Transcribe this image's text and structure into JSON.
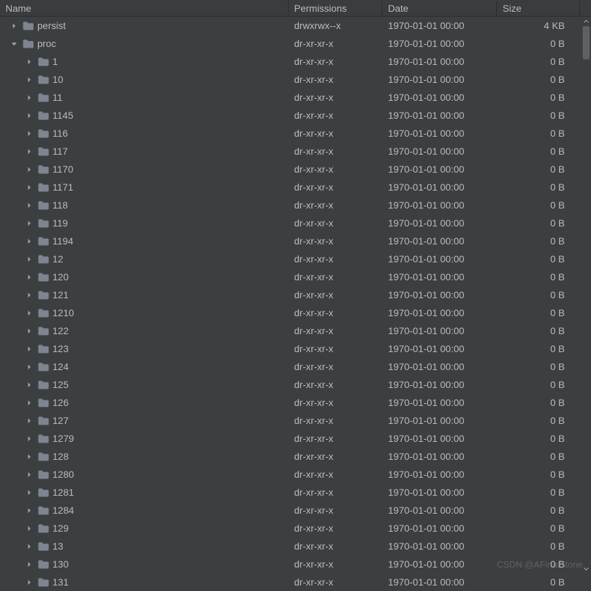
{
  "columns": {
    "name": "Name",
    "permissions": "Permissions",
    "date": "Date",
    "size": "Size"
  },
  "rows": [
    {
      "name": "persist",
      "permissions": "drwxrwx--x",
      "date": "1970-01-01 00:00",
      "size": "4 KB",
      "indent": 0,
      "expanded": false
    },
    {
      "name": "proc",
      "permissions": "dr-xr-xr-x",
      "date": "1970-01-01 00:00",
      "size": "0 B",
      "indent": 0,
      "expanded": true
    },
    {
      "name": "1",
      "permissions": "dr-xr-xr-x",
      "date": "1970-01-01 00:00",
      "size": "0 B",
      "indent": 1,
      "expanded": false
    },
    {
      "name": "10",
      "permissions": "dr-xr-xr-x",
      "date": "1970-01-01 00:00",
      "size": "0 B",
      "indent": 1,
      "expanded": false
    },
    {
      "name": "11",
      "permissions": "dr-xr-xr-x",
      "date": "1970-01-01 00:00",
      "size": "0 B",
      "indent": 1,
      "expanded": false
    },
    {
      "name": "1145",
      "permissions": "dr-xr-xr-x",
      "date": "1970-01-01 00:00",
      "size": "0 B",
      "indent": 1,
      "expanded": false
    },
    {
      "name": "116",
      "permissions": "dr-xr-xr-x",
      "date": "1970-01-01 00:00",
      "size": "0 B",
      "indent": 1,
      "expanded": false
    },
    {
      "name": "117",
      "permissions": "dr-xr-xr-x",
      "date": "1970-01-01 00:00",
      "size": "0 B",
      "indent": 1,
      "expanded": false
    },
    {
      "name": "1170",
      "permissions": "dr-xr-xr-x",
      "date": "1970-01-01 00:00",
      "size": "0 B",
      "indent": 1,
      "expanded": false
    },
    {
      "name": "1171",
      "permissions": "dr-xr-xr-x",
      "date": "1970-01-01 00:00",
      "size": "0 B",
      "indent": 1,
      "expanded": false
    },
    {
      "name": "118",
      "permissions": "dr-xr-xr-x",
      "date": "1970-01-01 00:00",
      "size": "0 B",
      "indent": 1,
      "expanded": false
    },
    {
      "name": "119",
      "permissions": "dr-xr-xr-x",
      "date": "1970-01-01 00:00",
      "size": "0 B",
      "indent": 1,
      "expanded": false
    },
    {
      "name": "1194",
      "permissions": "dr-xr-xr-x",
      "date": "1970-01-01 00:00",
      "size": "0 B",
      "indent": 1,
      "expanded": false
    },
    {
      "name": "12",
      "permissions": "dr-xr-xr-x",
      "date": "1970-01-01 00:00",
      "size": "0 B",
      "indent": 1,
      "expanded": false
    },
    {
      "name": "120",
      "permissions": "dr-xr-xr-x",
      "date": "1970-01-01 00:00",
      "size": "0 B",
      "indent": 1,
      "expanded": false
    },
    {
      "name": "121",
      "permissions": "dr-xr-xr-x",
      "date": "1970-01-01 00:00",
      "size": "0 B",
      "indent": 1,
      "expanded": false
    },
    {
      "name": "1210",
      "permissions": "dr-xr-xr-x",
      "date": "1970-01-01 00:00",
      "size": "0 B",
      "indent": 1,
      "expanded": false
    },
    {
      "name": "122",
      "permissions": "dr-xr-xr-x",
      "date": "1970-01-01 00:00",
      "size": "0 B",
      "indent": 1,
      "expanded": false
    },
    {
      "name": "123",
      "permissions": "dr-xr-xr-x",
      "date": "1970-01-01 00:00",
      "size": "0 B",
      "indent": 1,
      "expanded": false
    },
    {
      "name": "124",
      "permissions": "dr-xr-xr-x",
      "date": "1970-01-01 00:00",
      "size": "0 B",
      "indent": 1,
      "expanded": false
    },
    {
      "name": "125",
      "permissions": "dr-xr-xr-x",
      "date": "1970-01-01 00:00",
      "size": "0 B",
      "indent": 1,
      "expanded": false
    },
    {
      "name": "126",
      "permissions": "dr-xr-xr-x",
      "date": "1970-01-01 00:00",
      "size": "0 B",
      "indent": 1,
      "expanded": false
    },
    {
      "name": "127",
      "permissions": "dr-xr-xr-x",
      "date": "1970-01-01 00:00",
      "size": "0 B",
      "indent": 1,
      "expanded": false
    },
    {
      "name": "1279",
      "permissions": "dr-xr-xr-x",
      "date": "1970-01-01 00:00",
      "size": "0 B",
      "indent": 1,
      "expanded": false
    },
    {
      "name": "128",
      "permissions": "dr-xr-xr-x",
      "date": "1970-01-01 00:00",
      "size": "0 B",
      "indent": 1,
      "expanded": false
    },
    {
      "name": "1280",
      "permissions": "dr-xr-xr-x",
      "date": "1970-01-01 00:00",
      "size": "0 B",
      "indent": 1,
      "expanded": false
    },
    {
      "name": "1281",
      "permissions": "dr-xr-xr-x",
      "date": "1970-01-01 00:00",
      "size": "0 B",
      "indent": 1,
      "expanded": false
    },
    {
      "name": "1284",
      "permissions": "dr-xr-xr-x",
      "date": "1970-01-01 00:00",
      "size": "0 B",
      "indent": 1,
      "expanded": false
    },
    {
      "name": "129",
      "permissions": "dr-xr-xr-x",
      "date": "1970-01-01 00:00",
      "size": "0 B",
      "indent": 1,
      "expanded": false
    },
    {
      "name": "13",
      "permissions": "dr-xr-xr-x",
      "date": "1970-01-01 00:00",
      "size": "0 B",
      "indent": 1,
      "expanded": false
    },
    {
      "name": "130",
      "permissions": "dr-xr-xr-x",
      "date": "1970-01-01 00:00",
      "size": "0 B",
      "indent": 1,
      "expanded": false
    },
    {
      "name": "131",
      "permissions": "dr-xr-xr-x",
      "date": "1970-01-01 00:00",
      "size": "0 B",
      "indent": 1,
      "expanded": false
    }
  ],
  "watermark": "CSDN @AFinalStone"
}
